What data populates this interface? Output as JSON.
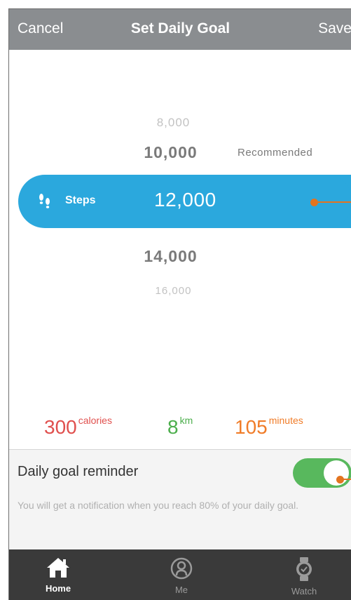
{
  "navbar": {
    "cancel": "Cancel",
    "title": "Set Daily Goal",
    "save": "Save"
  },
  "picker": {
    "options": [
      "8,000",
      "10,000",
      "12,000",
      "14,000",
      "16,000"
    ],
    "recommended_label": "Recommended",
    "selected_label": "Steps",
    "selected_value": "12,000"
  },
  "stats": {
    "calories": {
      "value": "300",
      "unit": "calories"
    },
    "distance": {
      "value": "8",
      "unit": "km"
    },
    "time": {
      "value": "105",
      "unit": "minutes"
    }
  },
  "reminder": {
    "title": "Daily goal reminder",
    "enabled": true,
    "description": "You will get a notification when you reach 80% of your daily goal."
  },
  "tabbar": {
    "items": [
      {
        "label": "Home",
        "icon": "home-icon",
        "active": true
      },
      {
        "label": "Me",
        "icon": "profile-icon",
        "active": false
      },
      {
        "label": "Watch",
        "icon": "watch-icon",
        "active": false
      }
    ]
  },
  "colors": {
    "accent_blue": "#2ba8dd",
    "calories": "#e0504e",
    "distance": "#4cae4c",
    "time": "#f07c28",
    "toggle_on": "#58b85d",
    "navbar": "#8a8d90",
    "tabbar": "#3a3a3a",
    "annotation": "#e3741f"
  }
}
